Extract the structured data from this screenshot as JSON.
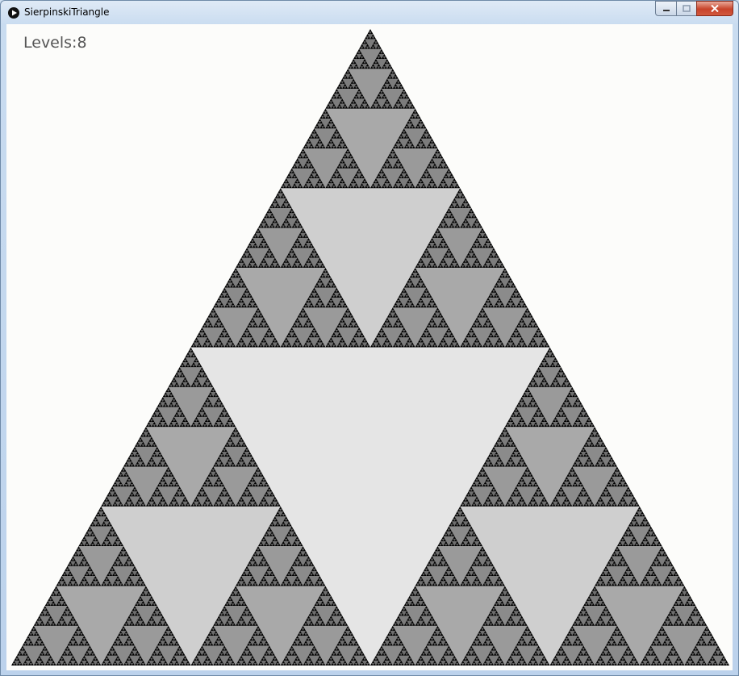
{
  "window": {
    "title": "SierpinskiTriangle",
    "icon": "processing-play-icon",
    "minimize_icon": "minimize-icon",
    "maximize_icon": "maximize-icon",
    "close_icon": "close-icon"
  },
  "sketch": {
    "levels_label": "Levels:",
    "levels_value": "8",
    "levels": 8,
    "colors": {
      "background": "#fcfcfa",
      "outer": "#000000",
      "level_colors": [
        "#e5e5e5",
        "#cfcfcf",
        "#a9a9a9",
        "#9a9a9a",
        "#8b8b8b",
        "#7c7c7c",
        "#6e6e6e",
        "#5f5f5f"
      ]
    }
  }
}
